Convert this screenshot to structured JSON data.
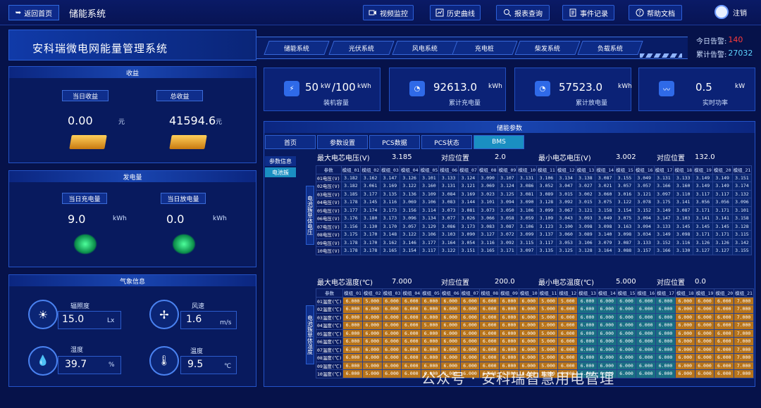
{
  "topbar": {
    "back_label": "返回首页",
    "system_name": "储能系统",
    "buttons": [
      "视频监控",
      "历史曲线",
      "报表查询",
      "事件记录",
      "帮助文档"
    ],
    "logout_label": "注销"
  },
  "banner": {
    "title": "安科瑞微电网能量管理系统"
  },
  "nav_tabs": [
    "储能系统",
    "光伏系统",
    "风电系统",
    "充电桩",
    "柴发系统",
    "负载系统"
  ],
  "alarms": {
    "today_label": "今日告警:",
    "today_value": "140",
    "total_label": "累计告警:",
    "total_value": "27032"
  },
  "income": {
    "title": "收益",
    "today_label": "当日收益",
    "today_value": "0.00",
    "today_unit": "元",
    "total_label": "总收益",
    "total_value": "41594.6",
    "total_unit": "元"
  },
  "generation": {
    "title": "发电量",
    "charge_label": "当日充电量",
    "charge_value": "9.0",
    "charge_unit": "kWh",
    "discharge_label": "当日放电量",
    "discharge_value": "0.0",
    "discharge_unit": "kWh"
  },
  "weather": {
    "title": "气象信息",
    "irradiance_label": "辐照度",
    "irradiance_value": "15.0",
    "irradiance_unit": "Lx",
    "wind_label": "风速",
    "wind_value": "1.6",
    "wind_unit": "m/s",
    "humidity_label": "湿度",
    "humidity_value": "39.7",
    "humidity_unit": "%",
    "temp_label": "温度",
    "temp_value": "9.5",
    "temp_unit": "℃"
  },
  "cards": [
    {
      "value": "50",
      "unit": "kW",
      "value2": "/100",
      "unit2": "kWh",
      "label": "装机容量"
    },
    {
      "value": "92613.0",
      "unit": "kWh",
      "label": "累计充电量"
    },
    {
      "value": "57523.0",
      "unit": "kWh",
      "label": "累计放电量"
    },
    {
      "value": "0.5",
      "unit": "kW",
      "label": "实时功率"
    }
  ],
  "params": {
    "title": "储能参数",
    "tabs": [
      "首页",
      "参数设置",
      "PCS数据",
      "PCS状态",
      "BMS"
    ],
    "side_items": [
      "参数信息",
      "电池簇"
    ],
    "voltage_vertical_label": "电池簇单体电压",
    "temp_vertical_label": "电池簇单体温度",
    "voltage_header": {
      "max_label": "最大电芯电压(V)",
      "max_value": "3.185",
      "pos_label": "对应位置",
      "pos_value": "2.0",
      "min_label": "最小电芯电压(V)",
      "min_value": "3.002",
      "pos2_label": "对应位置",
      "pos2_value": "132.0"
    },
    "temp_header": {
      "max_label": "最大电芯温度(℃)",
      "max_value": "7.000",
      "pos_label": "对应位置",
      "pos_value": "200.0",
      "min_label": "最小电芯温度(℃)",
      "min_value": "5.000",
      "pos2_label": "对应位置",
      "pos2_value": "0.0"
    },
    "param_label": "参数",
    "columns": [
      "模组_01",
      "模组_02",
      "模组_03",
      "模组_04",
      "模组_05",
      "模组_06",
      "模组_07",
      "模组_08",
      "模组_09",
      "模组_10",
      "模组_11",
      "模组_12",
      "模组_13",
      "模组_14",
      "模组_15",
      "模组_16",
      "模组_17",
      "模组_18",
      "模组_19",
      "模组_20",
      "模组_21"
    ],
    "voltage_rows": [
      {
        "name": "01电压(V)",
        "v": [
          "3.182",
          "3.162",
          "3.147",
          "3.126",
          "3.101",
          "3.133",
          "3.124",
          "3.090",
          "3.107",
          "3.131",
          "3.106",
          "3.134",
          "3.138",
          "3.087",
          "3.155",
          "3.049",
          "3.131",
          "3.133",
          "3.149",
          "3.149",
          "3.151"
        ]
      },
      {
        "name": "02电压(V)",
        "v": [
          "3.182",
          "3.061",
          "3.169",
          "3.122",
          "3.160",
          "3.131",
          "3.121",
          "3.069",
          "3.124",
          "3.086",
          "3.052",
          "3.047",
          "3.027",
          "3.021",
          "3.057",
          "3.057",
          "3.166",
          "3.160",
          "3.149",
          "3.149",
          "3.174"
        ]
      },
      {
        "name": "03电压(V)",
        "v": [
          "3.185",
          "3.177",
          "3.135",
          "3.136",
          "3.109",
          "3.084",
          "3.169",
          "3.023",
          "3.125",
          "3.081",
          "3.089",
          "3.015",
          "3.002",
          "3.060",
          "3.016",
          "3.121",
          "3.097",
          "3.110",
          "3.117",
          "3.117",
          "3.132"
        ]
      },
      {
        "name": "04电压(V)",
        "v": [
          "3.178",
          "3.145",
          "3.116",
          "3.069",
          "3.106",
          "3.083",
          "3.144",
          "3.101",
          "3.094",
          "3.090",
          "3.128",
          "3.092",
          "3.015",
          "3.075",
          "3.122",
          "3.078",
          "3.175",
          "3.141",
          "3.056",
          "3.056",
          "3.096"
        ]
      },
      {
        "name": "05电压(V)",
        "v": [
          "3.177",
          "3.174",
          "3.173",
          "3.156",
          "3.114",
          "3.073",
          "3.081",
          "3.073",
          "3.050",
          "3.106",
          "3.099",
          "3.067",
          "3.121",
          "3.158",
          "3.154",
          "3.152",
          "3.149",
          "3.087",
          "3.171",
          "3.171",
          "3.101"
        ]
      },
      {
        "name": "06电压(V)",
        "v": [
          "3.176",
          "3.180",
          "3.173",
          "3.096",
          "3.134",
          "3.077",
          "3.026",
          "3.066",
          "3.058",
          "3.059",
          "3.109",
          "3.043",
          "3.093",
          "3.049",
          "3.075",
          "3.094",
          "3.147",
          "3.103",
          "3.141",
          "3.141",
          "3.158"
        ]
      },
      {
        "name": "07电压(V)",
        "v": [
          "3.156",
          "3.130",
          "3.170",
          "3.057",
          "3.129",
          "3.086",
          "3.173",
          "3.083",
          "3.087",
          "3.106",
          "3.123",
          "3.100",
          "3.098",
          "3.098",
          "3.163",
          "3.094",
          "3.133",
          "3.145",
          "3.145",
          "3.145",
          "3.128"
        ]
      },
      {
        "name": "08电压(V)",
        "v": [
          "3.175",
          "3.170",
          "3.148",
          "3.122",
          "3.106",
          "3.103",
          "3.090",
          "3.127",
          "3.072",
          "3.099",
          "3.137",
          "3.060",
          "3.089",
          "3.140",
          "3.098",
          "3.034",
          "3.149",
          "3.098",
          "3.171",
          "3.171",
          "3.115"
        ]
      },
      {
        "name": "09电压(V)",
        "v": [
          "3.178",
          "3.170",
          "3.162",
          "3.146",
          "3.177",
          "3.164",
          "3.054",
          "3.116",
          "3.092",
          "3.115",
          "3.117",
          "3.053",
          "3.106",
          "3.079",
          "3.087",
          "3.133",
          "3.152",
          "3.116",
          "3.126",
          "3.126",
          "3.142"
        ]
      },
      {
        "name": "10电压(V)",
        "v": [
          "3.178",
          "3.178",
          "3.165",
          "3.154",
          "3.117",
          "3.122",
          "3.151",
          "3.165",
          "3.171",
          "3.097",
          "3.135",
          "3.125",
          "3.128",
          "3.164",
          "3.088",
          "3.157",
          "3.166",
          "3.130",
          "3.127",
          "3.127",
          "3.155"
        ]
      }
    ],
    "temp_rows": [
      {
        "name": "01温度(℃)",
        "v": [
          "6.000",
          "5.000",
          "6.000",
          "6.000",
          "6.000",
          "6.000",
          "6.000",
          "6.000",
          "6.000",
          "6.000",
          "5.000",
          "5.000",
          "6.000",
          "6.000",
          "6.000",
          "6.000",
          "6.000",
          "6.000",
          "6.000",
          "6.000",
          "7.000"
        ]
      },
      {
        "name": "02温度(℃)",
        "v": [
          "6.000",
          "6.000",
          "6.000",
          "6.000",
          "6.000",
          "6.000",
          "6.000",
          "6.000",
          "6.000",
          "6.000",
          "5.000",
          "6.000",
          "6.000",
          "6.000",
          "6.000",
          "6.000",
          "6.000",
          "6.000",
          "6.000",
          "6.000",
          "7.000"
        ]
      },
      {
        "name": "03温度(℃)",
        "v": [
          "6.000",
          "6.000",
          "6.000",
          "6.000",
          "6.000",
          "6.000",
          "6.000",
          "6.000",
          "6.000",
          "6.000",
          "5.000",
          "6.000",
          "6.000",
          "6.000",
          "6.000",
          "6.000",
          "6.000",
          "6.000",
          "6.000",
          "6.000",
          "7.000"
        ]
      },
      {
        "name": "04温度(℃)",
        "v": [
          "6.000",
          "6.000",
          "6.000",
          "6.000",
          "5.000",
          "6.000",
          "6.000",
          "6.000",
          "6.000",
          "6.000",
          "5.000",
          "6.000",
          "6.000",
          "6.000",
          "6.000",
          "6.000",
          "6.000",
          "6.000",
          "6.000",
          "6.000",
          "7.000"
        ]
      },
      {
        "name": "05温度(℃)",
        "v": [
          "6.000",
          "6.000",
          "6.000",
          "6.000",
          "6.000",
          "6.000",
          "6.000",
          "6.000",
          "6.000",
          "6.000",
          "5.000",
          "6.000",
          "6.000",
          "6.000",
          "6.000",
          "6.000",
          "6.000",
          "6.000",
          "6.000",
          "6.000",
          "7.000"
        ]
      },
      {
        "name": "06温度(℃)",
        "v": [
          "6.000",
          "6.000",
          "6.000",
          "6.000",
          "6.000",
          "6.000",
          "6.000",
          "6.000",
          "6.000",
          "6.000",
          "5.000",
          "6.000",
          "6.000",
          "6.000",
          "6.000",
          "6.000",
          "6.000",
          "6.000",
          "6.000",
          "6.000",
          "7.000"
        ]
      },
      {
        "name": "07温度(℃)",
        "v": [
          "6.000",
          "6.000",
          "6.000",
          "6.000",
          "6.000",
          "6.000",
          "6.000",
          "6.000",
          "6.000",
          "6.000",
          "5.000",
          "6.000",
          "6.000",
          "6.000",
          "6.000",
          "6.000",
          "6.000",
          "6.000",
          "6.000",
          "6.000",
          "7.000"
        ]
      },
      {
        "name": "08温度(℃)",
        "v": [
          "6.000",
          "6.000",
          "6.000",
          "6.000",
          "6.000",
          "6.000",
          "6.000",
          "6.000",
          "6.000",
          "6.000",
          "5.000",
          "6.000",
          "6.000",
          "6.000",
          "6.000",
          "6.000",
          "6.000",
          "6.000",
          "6.000",
          "6.000",
          "7.000"
        ]
      },
      {
        "name": "09温度(℃)",
        "v": [
          "6.000",
          "5.000",
          "6.000",
          "6.000",
          "6.000",
          "6.000",
          "6.000",
          "6.000",
          "6.000",
          "6.000",
          "5.000",
          "6.000",
          "6.000",
          "6.000",
          "6.000",
          "6.000",
          "6.000",
          "6.000",
          "6.000",
          "6.000",
          "7.000"
        ]
      },
      {
        "name": "10温度(℃)",
        "v": [
          "6.000",
          "5.000",
          "6.000",
          "6.000",
          "6.000",
          "6.000",
          "6.000",
          "6.000",
          "6.000",
          "6.000",
          "5.000",
          "6.000",
          "6.000",
          "6.000",
          "6.000",
          "6.000",
          "6.000",
          "6.000",
          "6.000",
          "6.000",
          "7.000"
        ]
      }
    ]
  },
  "watermark": "公众号 · 安科瑞智慧用电管理"
}
